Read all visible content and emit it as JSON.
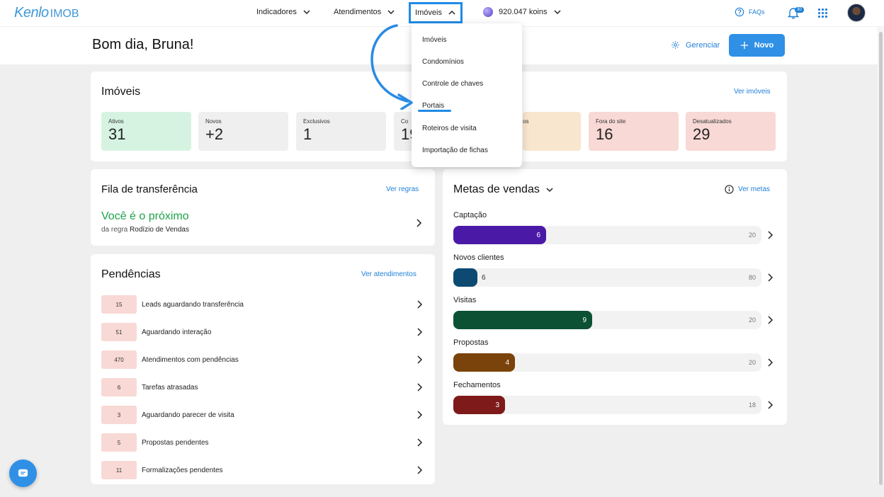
{
  "nav": {
    "logo_brand": "Kenlo",
    "logo_sub": "IMOB",
    "items": [
      {
        "label": "Indicadores"
      },
      {
        "label": "Atendimentos"
      },
      {
        "label": "Imóveis"
      }
    ],
    "koins": "920.047 koins",
    "faqs": "FAQs",
    "notifications": "30"
  },
  "header": {
    "greeting": "Bom dia, Bruna!",
    "manage": "Gerenciar",
    "new_button": "Novo"
  },
  "imoveis": {
    "title": "Imóveis",
    "link": "Ver imóveis",
    "stats": [
      {
        "label": "Ativos",
        "value": "31",
        "color": "#d6f3e1"
      },
      {
        "label": "Novos",
        "value": "+2",
        "color": "#efefef"
      },
      {
        "label": "Exclusivos",
        "value": "1",
        "color": "#efefef"
      },
      {
        "label": "Co",
        "value": "19",
        "color": "#efefef"
      },
      {
        "label": "os",
        "value": "",
        "color": "#f8e6cf"
      },
      {
        "label": "Fora do site",
        "value": "16",
        "color": "#f8d9d5"
      },
      {
        "label": "Desatualizados",
        "value": "29",
        "color": "#f8d9d5"
      }
    ]
  },
  "fila": {
    "title": "Fila de transferência",
    "link": "Ver regras",
    "next": "Você é o próximo",
    "rule_prefix": "da regra",
    "rule_name": "Rodízio de Vendas",
    "accent": "#1ea34a"
  },
  "pendencias": {
    "title": "Pendências",
    "link": "Ver atendimentos",
    "rows": [
      {
        "count": "15",
        "label": "Leads aguardando transferência"
      },
      {
        "count": "51",
        "label": "Aguardando interação"
      },
      {
        "count": "470",
        "label": "Atendimentos com pendências"
      },
      {
        "count": "6",
        "label": "Tarefas atrasadas"
      },
      {
        "count": "3",
        "label": "Aguardando parecer de visita"
      },
      {
        "count": "5",
        "label": "Propostas pendentes"
      },
      {
        "count": "11",
        "label": "Formalizações pendentes"
      }
    ]
  },
  "metas": {
    "title": "Metas de vendas",
    "link": "Ver metas",
    "goals": [
      {
        "label": "Captação",
        "value": "6",
        "total": "20",
        "color": "#4a1aa7",
        "fraction": 0.3
      },
      {
        "label": "Novos clientes",
        "value": "6",
        "total": "80",
        "color": "#0c4a72",
        "fraction": 0.075
      },
      {
        "label": "Visitas",
        "value": "9",
        "total": "20",
        "color": "#0c5134",
        "fraction": 0.45
      },
      {
        "label": "Propostas",
        "value": "4",
        "total": "20",
        "color": "#7a430b",
        "fraction": 0.2
      },
      {
        "label": "Fechamentos",
        "value": "3",
        "total": "18",
        "color": "#7f1a1a",
        "fraction": 0.1667
      }
    ]
  },
  "dropdown": {
    "items": [
      {
        "label": "Imóveis"
      },
      {
        "label": "Condomínios"
      },
      {
        "label": "Controle de chaves"
      },
      {
        "label": "Portais"
      },
      {
        "label": "Roteiros de visita"
      },
      {
        "label": "Importação de fichas"
      }
    ]
  }
}
